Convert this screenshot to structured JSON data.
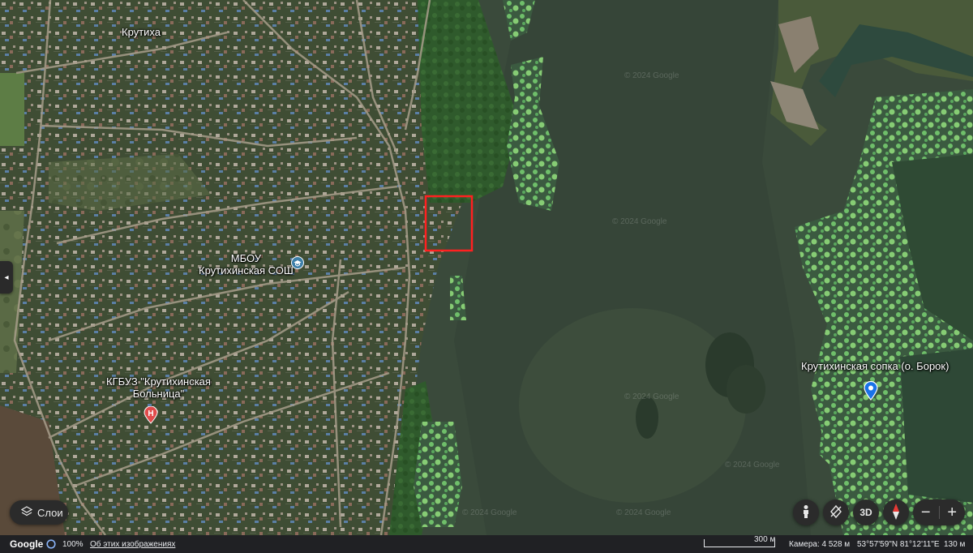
{
  "map": {
    "places": {
      "village": "Крутиха",
      "school": "МБОУ\nКрутихинская СОШ",
      "hospital": "КГБУЗ \"Крутихинская\nБольница\"",
      "hill": "Крутихинская сопка (о. Борок)"
    },
    "watermarks": [
      "© 2024 Google",
      "© 2024 Google",
      "© 2024 Google",
      "© 2024 Google",
      "© 2024 Google",
      "© 2024 Google"
    ],
    "selection_box_color": "#ff2020",
    "pin_color": "#1a73e8"
  },
  "controls": {
    "side_toggle": "◂",
    "layers_label": "Слои",
    "pegman_icon": "person-icon",
    "orientation_icon": "tilt-icon",
    "view_3d_label": "3D",
    "compass_icon": "compass-icon",
    "zoom_out": "−",
    "zoom_in": "+"
  },
  "footer": {
    "logo": "Google",
    "zoom_level": "100%",
    "imagery_link": "Об этих изображениях",
    "scale_label": "300 м",
    "camera": "Камера: 4 528 м",
    "coordinates": "53°57'59\"N 81°12'11\"E",
    "elevation": "130 м"
  },
  "colors": {
    "land": "#3d4a33",
    "water": "#3a4a3b",
    "algae": "#6fbf6a",
    "footer_bg": "#202124"
  }
}
